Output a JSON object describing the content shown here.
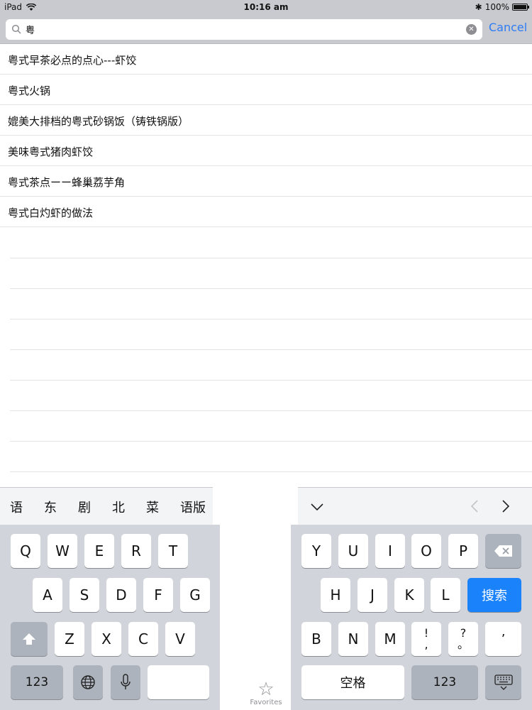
{
  "status": {
    "device": "iPad",
    "time": "10:16 am",
    "battery": "100%",
    "battery_level": 1.0
  },
  "search": {
    "query": "粤",
    "cancel_label": "Cancel"
  },
  "results": [
    "粤式早茶必点的点心---虾饺",
    "粤式火锅",
    "媲美大排档的粤式砂锅饭（铸铁锅版）",
    "美味粤式猪肉虾饺",
    "粤式茶点ーー蜂巢荔芋角",
    "粤式白灼虾的做法"
  ],
  "keyboard": {
    "suggestions": [
      "语",
      "东",
      "剧",
      "北",
      "菜",
      "语版"
    ],
    "left": {
      "row1": [
        "Q",
        "W",
        "E",
        "R",
        "T"
      ],
      "row2": [
        "A",
        "S",
        "D",
        "F",
        "G"
      ],
      "row3": [
        "Z",
        "X",
        "C",
        "V"
      ],
      "num_label": "123"
    },
    "right": {
      "row1": [
        "Y",
        "U",
        "I",
        "O",
        "P"
      ],
      "row2": [
        "H",
        "J",
        "K",
        "L"
      ],
      "search_label": "搜索",
      "row3": [
        "B",
        "N",
        "M"
      ],
      "punct1": "!\n,",
      "punct2": "?\n。",
      "punct3": "’",
      "space_label": "空格",
      "num_label": "123"
    }
  },
  "tab": {
    "favorites_label": "Favorites"
  },
  "colors": {
    "accent": "#2d7cf6",
    "search_key": "#1a82fb"
  }
}
